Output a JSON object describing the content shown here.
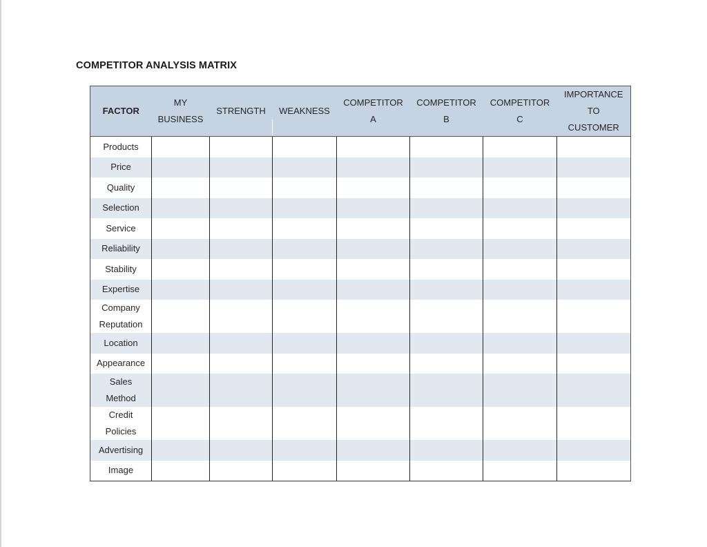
{
  "document": {
    "title": "COMPETITOR ANALYSIS MATRIX"
  },
  "table": {
    "headers": [
      "FACTOR",
      "MY BUSINESS",
      "STRENGTH",
      "WEAKNESS",
      "COMPETITOR A",
      "COMPETITOR B",
      "COMPETITOR C",
      "IMPORTANCE TO CUSTOMER"
    ],
    "header_lines": [
      [
        "FACTOR"
      ],
      [
        "MY",
        "BUSINESS"
      ],
      [
        "STRENGTH"
      ],
      [
        "WEAKNESS"
      ],
      [
        "COMPETITOR",
        "A"
      ],
      [
        "COMPETITOR",
        "B"
      ],
      [
        "COMPETITOR",
        "C"
      ],
      [
        "IMPORTANCE",
        "TO",
        "CUSTOMER"
      ]
    ],
    "rows": [
      {
        "factor": "Products",
        "lines": [
          "Products"
        ]
      },
      {
        "factor": "Price",
        "lines": [
          "Price"
        ]
      },
      {
        "factor": "Quality",
        "lines": [
          "Quality"
        ]
      },
      {
        "factor": "Selection",
        "lines": [
          "Selection"
        ]
      },
      {
        "factor": "Service",
        "lines": [
          "Service"
        ]
      },
      {
        "factor": "Reliability",
        "lines": [
          "Reliability"
        ]
      },
      {
        "factor": "Stability",
        "lines": [
          "Stability"
        ]
      },
      {
        "factor": "Expertise",
        "lines": [
          "Expertise"
        ]
      },
      {
        "factor": "Company Reputation",
        "lines": [
          "Company",
          "Reputation"
        ]
      },
      {
        "factor": "Location",
        "lines": [
          "Location"
        ]
      },
      {
        "factor": "Appearance",
        "lines": [
          "Appearance"
        ]
      },
      {
        "factor": "Sales Method",
        "lines": [
          "Sales",
          "Method"
        ]
      },
      {
        "factor": "Credit Policies",
        "lines": [
          "Credit",
          "Policies"
        ]
      },
      {
        "factor": "Advertising",
        "lines": [
          "Advertising"
        ]
      },
      {
        "factor": "Image",
        "lines": [
          "Image"
        ]
      }
    ]
  },
  "colors": {
    "header_bg": "#c5d3e3",
    "band_bg": "#e2e8f0"
  }
}
